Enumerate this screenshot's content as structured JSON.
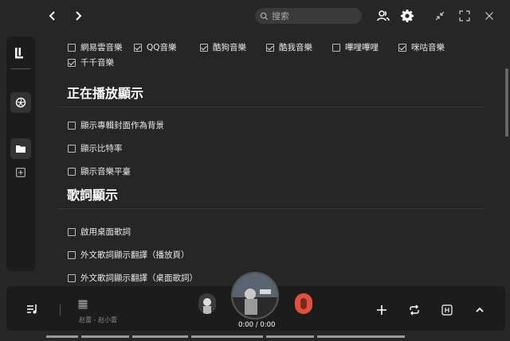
{
  "search": {
    "placeholder": "搜索"
  },
  "sources": [
    {
      "label": "網易雲音樂",
      "checked": false
    },
    {
      "label": "QQ音樂",
      "checked": true
    },
    {
      "label": "酷狗音樂",
      "checked": true
    },
    {
      "label": "酷我音樂",
      "checked": true
    },
    {
      "label": "嗶哩嗶哩",
      "checked": false
    },
    {
      "label": "咪咕音樂",
      "checked": true
    },
    {
      "label": "千千音樂",
      "checked": true
    }
  ],
  "sections": {
    "playing": {
      "title": "正在播放顯示",
      "options": [
        {
          "label": "顯示專輯封面作為背景",
          "checked": false
        },
        {
          "label": "顯示比特率",
          "checked": false
        },
        {
          "label": "顯示音樂平臺",
          "checked": false
        }
      ]
    },
    "lyrics": {
      "title": "歌詞顯示",
      "options": [
        {
          "label": "啟用桌面歌詞",
          "checked": false
        },
        {
          "label": "外文歌詞顯示翻譯（播放頁）",
          "checked": false
        },
        {
          "label": "外文歌詞顯示翻譯（桌面歌詞）",
          "checked": false
        }
      ]
    }
  },
  "player": {
    "song_meta": "赵雷 - 赵小雷",
    "time": "0:00 / 0:00"
  },
  "colors": {
    "background": "#262626",
    "panel": "#1c1c1c",
    "accent_red": "#e0503c"
  }
}
